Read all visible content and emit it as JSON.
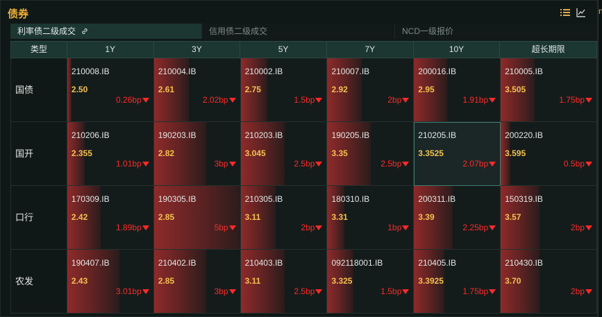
{
  "header": {
    "title": "债券"
  },
  "side_char": "n",
  "tabs": [
    {
      "label": "利率债二级成交",
      "active": true
    },
    {
      "label": "信用债二级成交",
      "active": false
    },
    {
      "label": "NCD一级报价",
      "active": false
    }
  ],
  "columns": [
    "类型",
    "1Y",
    "3Y",
    "5Y",
    "7Y",
    "10Y",
    "超长期限"
  ],
  "rows": [
    {
      "label": "国债",
      "cells": [
        {
          "code": "210008.IB",
          "yield": "2.50",
          "change": "0.26bp",
          "bar": 0.05
        },
        {
          "code": "210004.IB",
          "yield": "2.61",
          "change": "2.02bp",
          "bar": 0.4
        },
        {
          "code": "210002.IB",
          "yield": "2.75",
          "change": "1.5bp",
          "bar": 0.3
        },
        {
          "code": "210007.IB",
          "yield": "2.92",
          "change": "2bp",
          "bar": 0.4
        },
        {
          "code": "200016.IB",
          "yield": "2.95",
          "change": "1.91bp",
          "bar": 0.38
        },
        {
          "code": "210005.IB",
          "yield": "3.505",
          "change": "1.75bp",
          "bar": 0.35
        }
      ]
    },
    {
      "label": "国开",
      "cells": [
        {
          "code": "210206.IB",
          "yield": "2.355",
          "change": "1.01bp",
          "bar": 0.2
        },
        {
          "code": "190203.IB",
          "yield": "2.82",
          "change": "3bp",
          "bar": 0.6
        },
        {
          "code": "210203.IB",
          "yield": "3.045",
          "change": "2.5bp",
          "bar": 0.5
        },
        {
          "code": "190205.IB",
          "yield": "3.35",
          "change": "2.5bp",
          "bar": 0.5
        },
        {
          "code": "210205.IB",
          "yield": "3.3525",
          "change": "2.07bp",
          "bar": 0.0,
          "selected": true
        },
        {
          "code": "200220.IB",
          "yield": "3.595",
          "change": "0.5bp",
          "bar": 0.1
        }
      ]
    },
    {
      "label": "口行",
      "cells": [
        {
          "code": "170309.IB",
          "yield": "2.42",
          "change": "1.89bp",
          "bar": 0.38
        },
        {
          "code": "190305.IB",
          "yield": "2.85",
          "change": "5bp",
          "bar": 1.0
        },
        {
          "code": "210305.IB",
          "yield": "3.11",
          "change": "2bp",
          "bar": 0.4
        },
        {
          "code": "180310.IB",
          "yield": "3.31",
          "change": "1bp",
          "bar": 0.2
        },
        {
          "code": "200311.IB",
          "yield": "3.39",
          "change": "2.25bp",
          "bar": 0.45
        },
        {
          "code": "150319.IB",
          "yield": "3.57",
          "change": "2bp",
          "bar": 0.4
        }
      ]
    },
    {
      "label": "农发",
      "cells": [
        {
          "code": "190407.IB",
          "yield": "2.43",
          "change": "3.01bp",
          "bar": 0.6
        },
        {
          "code": "210402.IB",
          "yield": "2.85",
          "change": "3bp",
          "bar": 0.6
        },
        {
          "code": "210403.IB",
          "yield": "3.11",
          "change": "2.5bp",
          "bar": 0.5
        },
        {
          "code": "092118001.IB",
          "yield": "3.325",
          "change": "1.5bp",
          "bar": 0.3
        },
        {
          "code": "210405.IB",
          "yield": "3.3925",
          "change": "1.75bp",
          "bar": 0.35
        },
        {
          "code": "210430.IB",
          "yield": "3.70",
          "change": "2bp",
          "bar": 0.4
        }
      ]
    }
  ],
  "icons": {
    "list": "list-icon",
    "chart": "line-chart-icon",
    "link": "link-icon",
    "change_direction": "triangle-down-icon"
  },
  "colors": {
    "title": "#f0b03a",
    "yield": "#f2c150",
    "change": "#ff2a2a",
    "header_bg": "#1c3631"
  }
}
